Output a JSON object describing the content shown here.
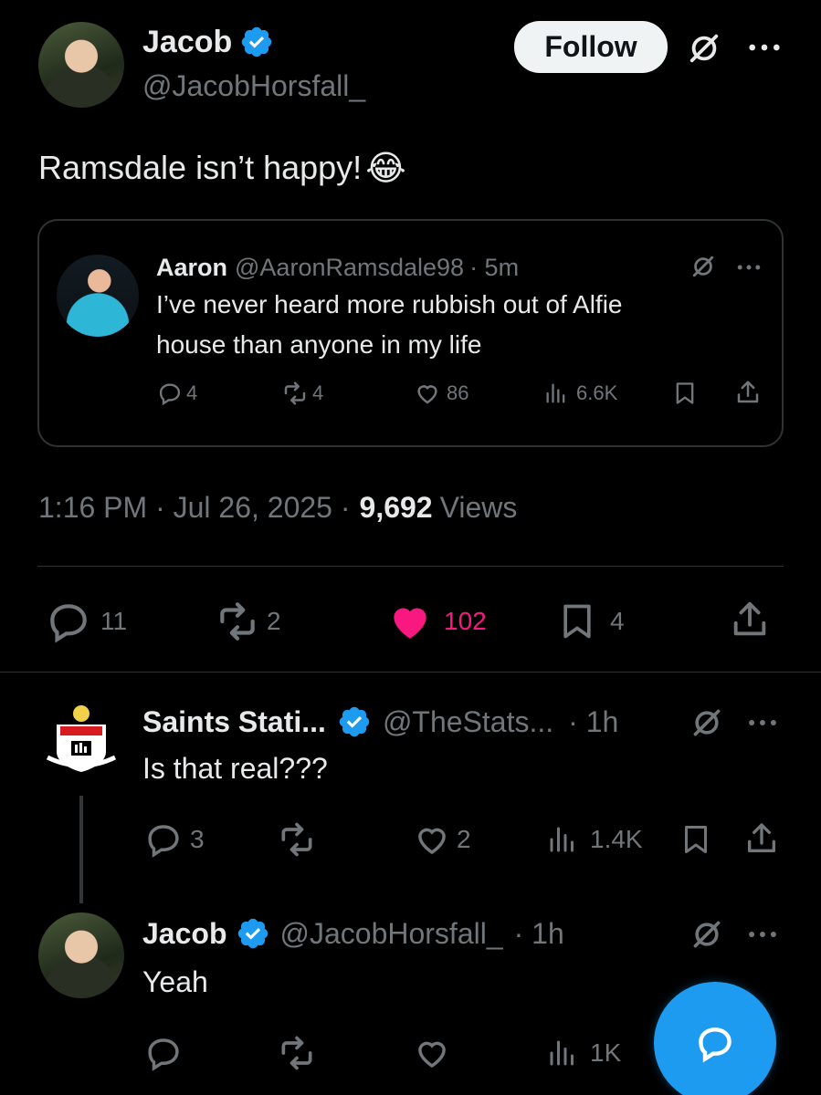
{
  "main_tweet": {
    "author_name": "Jacob",
    "author_handle": "@JacobHorsfall_",
    "follow_label": "Follow",
    "text": "Ramsdale isn’t happy!",
    "emoji": "😂",
    "timestamp": "1:16 PM · Jul 26, 2025 ·",
    "views_count": "9,692",
    "views_label": "Views",
    "stats": {
      "replies": "11",
      "reposts": "2",
      "likes": "102",
      "bookmarks": "4"
    }
  },
  "quoted_tweet": {
    "author_name": "Aaron",
    "author_handle": "@AaronRamsdale98",
    "time": "· 5m",
    "text_line1": "I’ve never heard more rubbish out of Alfie",
    "text_line2": "house than anyone in my life",
    "stats": {
      "replies": "4",
      "reposts": "4",
      "likes": "86",
      "views": "6.6K"
    }
  },
  "replies": [
    {
      "author_name": "Saints Stati...",
      "author_handle": "@TheStats...",
      "time": "· 1h",
      "text": "Is that real???",
      "stats": {
        "replies": "3",
        "reposts": "",
        "likes": "2",
        "views": "1.4K"
      }
    },
    {
      "author_name": "Jacob",
      "author_handle": "@JacobHorsfall_",
      "time": "· 1h",
      "text": "Yeah",
      "stats": {
        "replies": "",
        "reposts": "",
        "likes": "",
        "views": "1K"
      }
    }
  ],
  "colors": {
    "background": "#000000",
    "text": "#e7e9ea",
    "muted": "#71767b",
    "like": "#f91880",
    "accent": "#1d9bf0",
    "border": "#2f3336"
  },
  "icons": [
    "verified-badge-icon",
    "grok-icon",
    "more-icon",
    "reply-icon",
    "repost-icon",
    "like-icon",
    "views-icon",
    "bookmark-icon",
    "share-icon",
    "compose-reply-icon"
  ]
}
